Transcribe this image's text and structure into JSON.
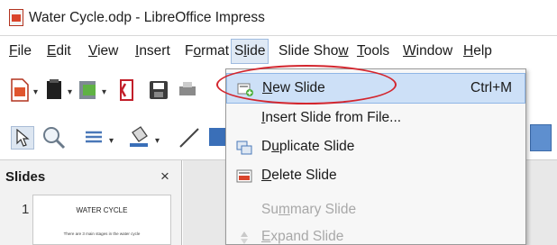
{
  "window": {
    "title": "Water Cycle.odp - LibreOffice Impress"
  },
  "menubar": {
    "items": [
      {
        "pre": "",
        "acc": "F",
        "post": "ile"
      },
      {
        "pre": "",
        "acc": "E",
        "post": "dit"
      },
      {
        "pre": "",
        "acc": "V",
        "post": "iew"
      },
      {
        "pre": "",
        "acc": "I",
        "post": "nsert"
      },
      {
        "pre": "F",
        "acc": "o",
        "post": "rmat"
      },
      {
        "pre": "S",
        "acc": "l",
        "post": "ide"
      },
      {
        "pre": "Slide Sho",
        "acc": "w",
        "post": ""
      },
      {
        "pre": "",
        "acc": "T",
        "post": "ools"
      },
      {
        "pre": "",
        "acc": "W",
        "post": "indow"
      },
      {
        "pre": "",
        "acc": "H",
        "post": "elp"
      }
    ]
  },
  "slide_menu": {
    "items": [
      {
        "pre": "",
        "acc": "N",
        "post": "ew Slide",
        "shortcut": "Ctrl+M",
        "icon": "new-slide-icon",
        "enabled": true,
        "highlighted": true
      },
      {
        "pre": "",
        "acc": "I",
        "post": "nsert Slide from File...",
        "shortcut": "",
        "icon": "",
        "enabled": true,
        "highlighted": false
      },
      {
        "pre": "D",
        "acc": "u",
        "post": "plicate Slide",
        "shortcut": "",
        "icon": "duplicate-slide-icon",
        "enabled": true,
        "highlighted": false
      },
      {
        "pre": "",
        "acc": "D",
        "post": "elete Slide",
        "shortcut": "",
        "icon": "delete-slide-icon",
        "enabled": true,
        "highlighted": false
      },
      {
        "pre": "Su",
        "acc": "m",
        "post": "mary Slide",
        "shortcut": "",
        "icon": "",
        "enabled": false,
        "highlighted": false
      },
      {
        "pre": "",
        "acc": "E",
        "post": "xpand Slide",
        "shortcut": "",
        "icon": "expand-slide-icon",
        "enabled": false,
        "highlighted": false
      }
    ]
  },
  "slides_pane": {
    "title": "Slides",
    "close": "×",
    "thumbnail": {
      "number": "1",
      "title": "WATER CYCLE",
      "body": "There are 3 main stages in the water cycle"
    }
  },
  "colors": {
    "highlight": "#cde0f7",
    "annotation": "#d3262e",
    "accent": "#d9442b"
  }
}
